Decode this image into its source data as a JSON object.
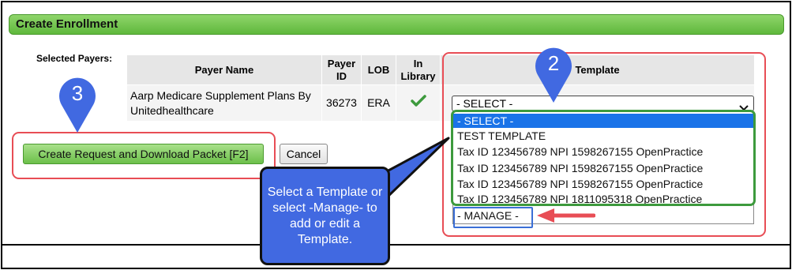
{
  "header": {
    "title": "Create Enrollment"
  },
  "selected_payers_label": "Selected Payers:",
  "table": {
    "headers": {
      "payer_name": "Payer Name",
      "payer_id": "Payer ID",
      "lob": "LOB",
      "in_library": "In Library",
      "template": "Template"
    },
    "row": {
      "payer_name": "Aarp Medicare Supplement Plans By Unitedhealthcare",
      "payer_id": "36273",
      "lob": "ERA",
      "in_library_icon": "checkmark-icon"
    }
  },
  "template_select": {
    "selected": "- SELECT -",
    "options": [
      "- SELECT -",
      "TEST TEMPLATE",
      "Tax ID 123456789 NPI 1598267155 OpenPractice",
      "Tax ID 123456789 NPI 1598267155 OpenPractice",
      "Tax ID 123456789 NPI 1598267155 OpenPractice",
      "Tax ID 123456789 NPI 1811095318 OpenPractice",
      "- MANAGE -"
    ]
  },
  "buttons": {
    "create": "Create Request and Download Packet [F2]",
    "cancel": "Cancel"
  },
  "annotations": {
    "pin_2": "2",
    "pin_3": "3",
    "callout_text": "Select a Template or select -Manage- to add or edit a Template."
  },
  "colors": {
    "header_green": "#6cc04a",
    "highlight_red": "#e84d55",
    "highlight_green": "#3d9a3d",
    "highlight_blue": "#3b6fd6",
    "pin_blue": "#4169e1",
    "option_selected": "#1a73e8"
  }
}
